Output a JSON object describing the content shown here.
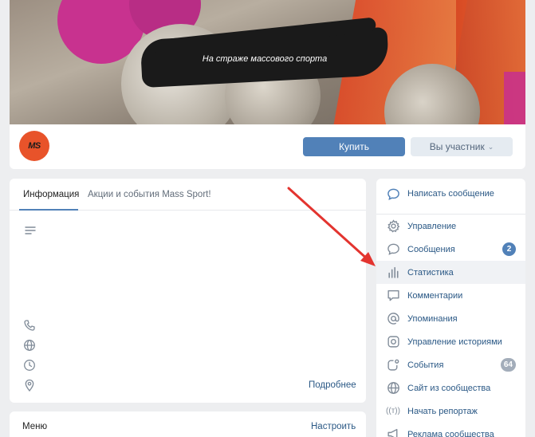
{
  "cover": {
    "slogan": "На страже массового спорта"
  },
  "header": {
    "avatar_text": "MS",
    "buy_label": "Купить",
    "member_label": "Вы участник"
  },
  "tabs": [
    {
      "label": "Информация"
    },
    {
      "label": "Акции и события Mass Sport!"
    }
  ],
  "info": {
    "more_label": "Подробнее"
  },
  "menu": {
    "title": "Меню",
    "setup_label": "Настроить"
  },
  "sidebar": {
    "write_label": "Написать сообщение",
    "items": [
      {
        "label": "Управление",
        "icon": "gear-icon"
      },
      {
        "label": "Сообщения",
        "icon": "chat-icon",
        "badge": "2"
      },
      {
        "label": "Статистика",
        "icon": "bar-chart-icon"
      },
      {
        "label": "Комментарии",
        "icon": "comment-icon"
      },
      {
        "label": "Упоминания",
        "icon": "at-icon"
      },
      {
        "label": "Управление историями",
        "icon": "stories-icon"
      },
      {
        "label": "События",
        "icon": "events-icon",
        "badge": "64"
      },
      {
        "label": "Сайт из сообщества",
        "icon": "globe-icon"
      },
      {
        "label": "Начать репортаж",
        "icon": "broadcast-icon"
      },
      {
        "label": "Реклама сообщества",
        "icon": "megaphone-icon"
      }
    ]
  },
  "colors": {
    "accent": "#5181b8",
    "link": "#2a5885",
    "bg": "#edeef0",
    "arrow": "#e3342f"
  }
}
